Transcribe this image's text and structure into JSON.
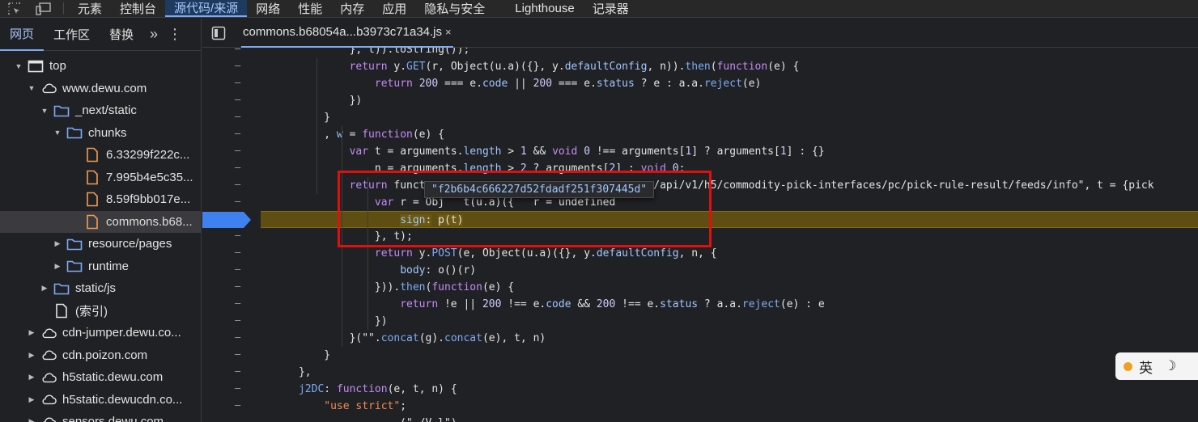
{
  "top_tabs": [
    "元素",
    "控制台",
    "源代码/来源",
    "网络",
    "性能",
    "内存",
    "应用",
    "隐私与安全",
    "Lighthouse",
    "记录器"
  ],
  "active_top_tab": "源代码/来源",
  "navigator": {
    "tabs": [
      "网页",
      "工作区",
      "替换"
    ],
    "more": "»",
    "tree": [
      {
        "label": "top",
        "depth": 0,
        "arrow": "down",
        "icon": "frame"
      },
      {
        "label": "www.dewu.com",
        "depth": 1,
        "arrow": "down",
        "icon": "cloud"
      },
      {
        "label": "_next/static",
        "depth": 2,
        "arrow": "down",
        "icon": "folder"
      },
      {
        "label": "chunks",
        "depth": 3,
        "arrow": "down",
        "icon": "folder"
      },
      {
        "label": "6.33299f222c...",
        "depth": 4,
        "arrow": "none",
        "icon": "file-orange"
      },
      {
        "label": "7.995b4e5c35...",
        "depth": 4,
        "arrow": "none",
        "icon": "file-orange"
      },
      {
        "label": "8.59f9bb017e...",
        "depth": 4,
        "arrow": "none",
        "icon": "file-orange"
      },
      {
        "label": "commons.b68...",
        "depth": 4,
        "arrow": "none",
        "icon": "file-orange",
        "selected": true
      },
      {
        "label": "resource/pages",
        "depth": 3,
        "arrow": "right",
        "icon": "folder"
      },
      {
        "label": "runtime",
        "depth": 3,
        "arrow": "right",
        "icon": "folder"
      },
      {
        "label": "static/js",
        "depth": 2,
        "arrow": "right",
        "icon": "folder"
      },
      {
        "label": "(索引)",
        "depth": 2,
        "arrow": "none",
        "icon": "file-white"
      },
      {
        "label": "cdn-jumper.dewu.co...",
        "depth": 1,
        "arrow": "right",
        "icon": "cloud"
      },
      {
        "label": "cdn.poizon.com",
        "depth": 1,
        "arrow": "right",
        "icon": "cloud"
      },
      {
        "label": "h5static.dewu.com",
        "depth": 1,
        "arrow": "right",
        "icon": "cloud"
      },
      {
        "label": "h5static.dewucdn.co...",
        "depth": 1,
        "arrow": "right",
        "icon": "cloud"
      },
      {
        "label": "sensors.dewu.com",
        "depth": 1,
        "arrow": "right",
        "icon": "cloud"
      }
    ]
  },
  "editor": {
    "file_tab": "commons.b68054a...b3973c71a34.js",
    "close": "×",
    "tooltip": "\"f2b6b4c666227d52fdadf251f307445d\"",
    "ime": {
      "char": "英",
      "moon": "☽"
    },
    "lines": [
      {
        "indent": 7,
        "html": "}, t)).toString());"
      },
      {
        "indent": 7,
        "html": "<span class='kw'>return</span> y.<span class='fn'>GET</span>(r, Object(u.a)({}, y.<span class='prop'>defaultConfig</span>, n)).<span class='fn'>then</span>(<span class='kw'>function</span>(e) {"
      },
      {
        "indent": 9,
        "html": "<span class='kw'>return</span> <span class='num'>200</span> === e.<span class='prop'>code</span> || <span class='num'>200</span> === e.<span class='prop'>status</span> ? e : a.a.<span class='fn'>reject</span>(e)"
      },
      {
        "indent": 7,
        "html": "})"
      },
      {
        "indent": 5,
        "html": "}"
      },
      {
        "indent": 5,
        "html": ", <span class='prop'>w</span> = <span class='kw'>function</span>(e) {"
      },
      {
        "indent": 7,
        "html": "<span class='kw'>var</span> t = arguments.<span class='prop'>length</span> &gt; <span class='num'>1</span> &amp;&amp; <span class='kw'>void</span> <span class='num'>0</span> !== arguments[<span class='num'>1</span>] ? arguments[<span class='num'>1</span>] : {}"
      },
      {
        "indent": 9,
        "html": "n = arguments.<span class='prop'>length</span> &gt; <span class='num'>2</span> ? arguments[<span class='num'>2</span>] : <span class='kw'>void</span> <span class='num'>0</span>;"
      },
      {
        "indent": 7,
        "html": "<span class='kw'>return</span> funct                                .com/api/v1/h5/commodity-pick-interfaces/pc/pick-rule-result/feeds/info\", t = {pick"
      },
      {
        "indent": 9,
        "html": "<span class='kw'>var</span> r = Obj   t(u.a)({   r = undefined"
      },
      {
        "indent": 11,
        "html": "<span class='hl'><span class='prop'>sign</span>:</span> <span class='hl'>p(t)</span>"
      },
      {
        "indent": 9,
        "html": "}, t);"
      },
      {
        "indent": 9,
        "html": "<span class='kw'>return</span> y.<span class='fn'>POST</span>(e, Object(u.a)({}, y.<span class='prop'>defaultConfig</span>, n, {"
      },
      {
        "indent": 11,
        "html": "<span class='prop'>body</span>: o()(r)"
      },
      {
        "indent": 9,
        "html": "})).<span class='fn'>then</span>(<span class='kw'>function</span>(e) {"
      },
      {
        "indent": 11,
        "html": "<span class='kw'>return</span> !e || <span class='num'>200</span> !== e.<span class='prop'>code</span> &amp;&amp; <span class='num'>200</span> !== e.<span class='prop'>status</span> ? a.a.<span class='fn'>reject</span>(e) : e"
      },
      {
        "indent": 9,
        "html": "})"
      },
      {
        "indent": 7,
        "html": "}(\"\".<span class='fn'>concat</span>(g).<span class='fn'>concat</span>(e), t, n)"
      },
      {
        "indent": 5,
        "html": "}"
      },
      {
        "indent": 3,
        "html": "},"
      },
      {
        "indent": 3,
        "html": "<span class='fn'>j2DC</span>: <span class='kw'>function</span>(e, t, n) {"
      },
      {
        "indent": 5,
        "html": "<span class='str'>\"use strict\"</span>;"
      },
      {
        "indent": 11,
        "html": "(\"./V.l\")"
      }
    ],
    "paused_line": 10
  }
}
